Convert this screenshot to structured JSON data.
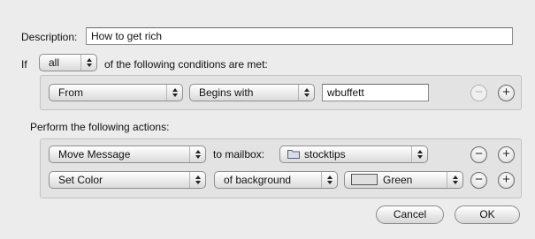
{
  "description": {
    "label": "Description:",
    "value": "How to get rich"
  },
  "conditions": {
    "if_label": "If",
    "match_value": "all",
    "suffix": "of the following conditions are met:",
    "rows": [
      {
        "field": "From",
        "operator": "Begins with",
        "value": "wbuffett",
        "minus": "−",
        "plus": "+"
      }
    ]
  },
  "actions": {
    "label": "Perform the following actions:",
    "rows": [
      {
        "action": "Move Message",
        "connector": "to mailbox:",
        "target": "stocktips",
        "minus": "−",
        "plus": "+"
      },
      {
        "action": "Set Color",
        "connector": "of background",
        "target": "Green",
        "minus": "−",
        "plus": "+"
      }
    ]
  },
  "buttons": {
    "cancel": "Cancel",
    "ok": "OK"
  }
}
